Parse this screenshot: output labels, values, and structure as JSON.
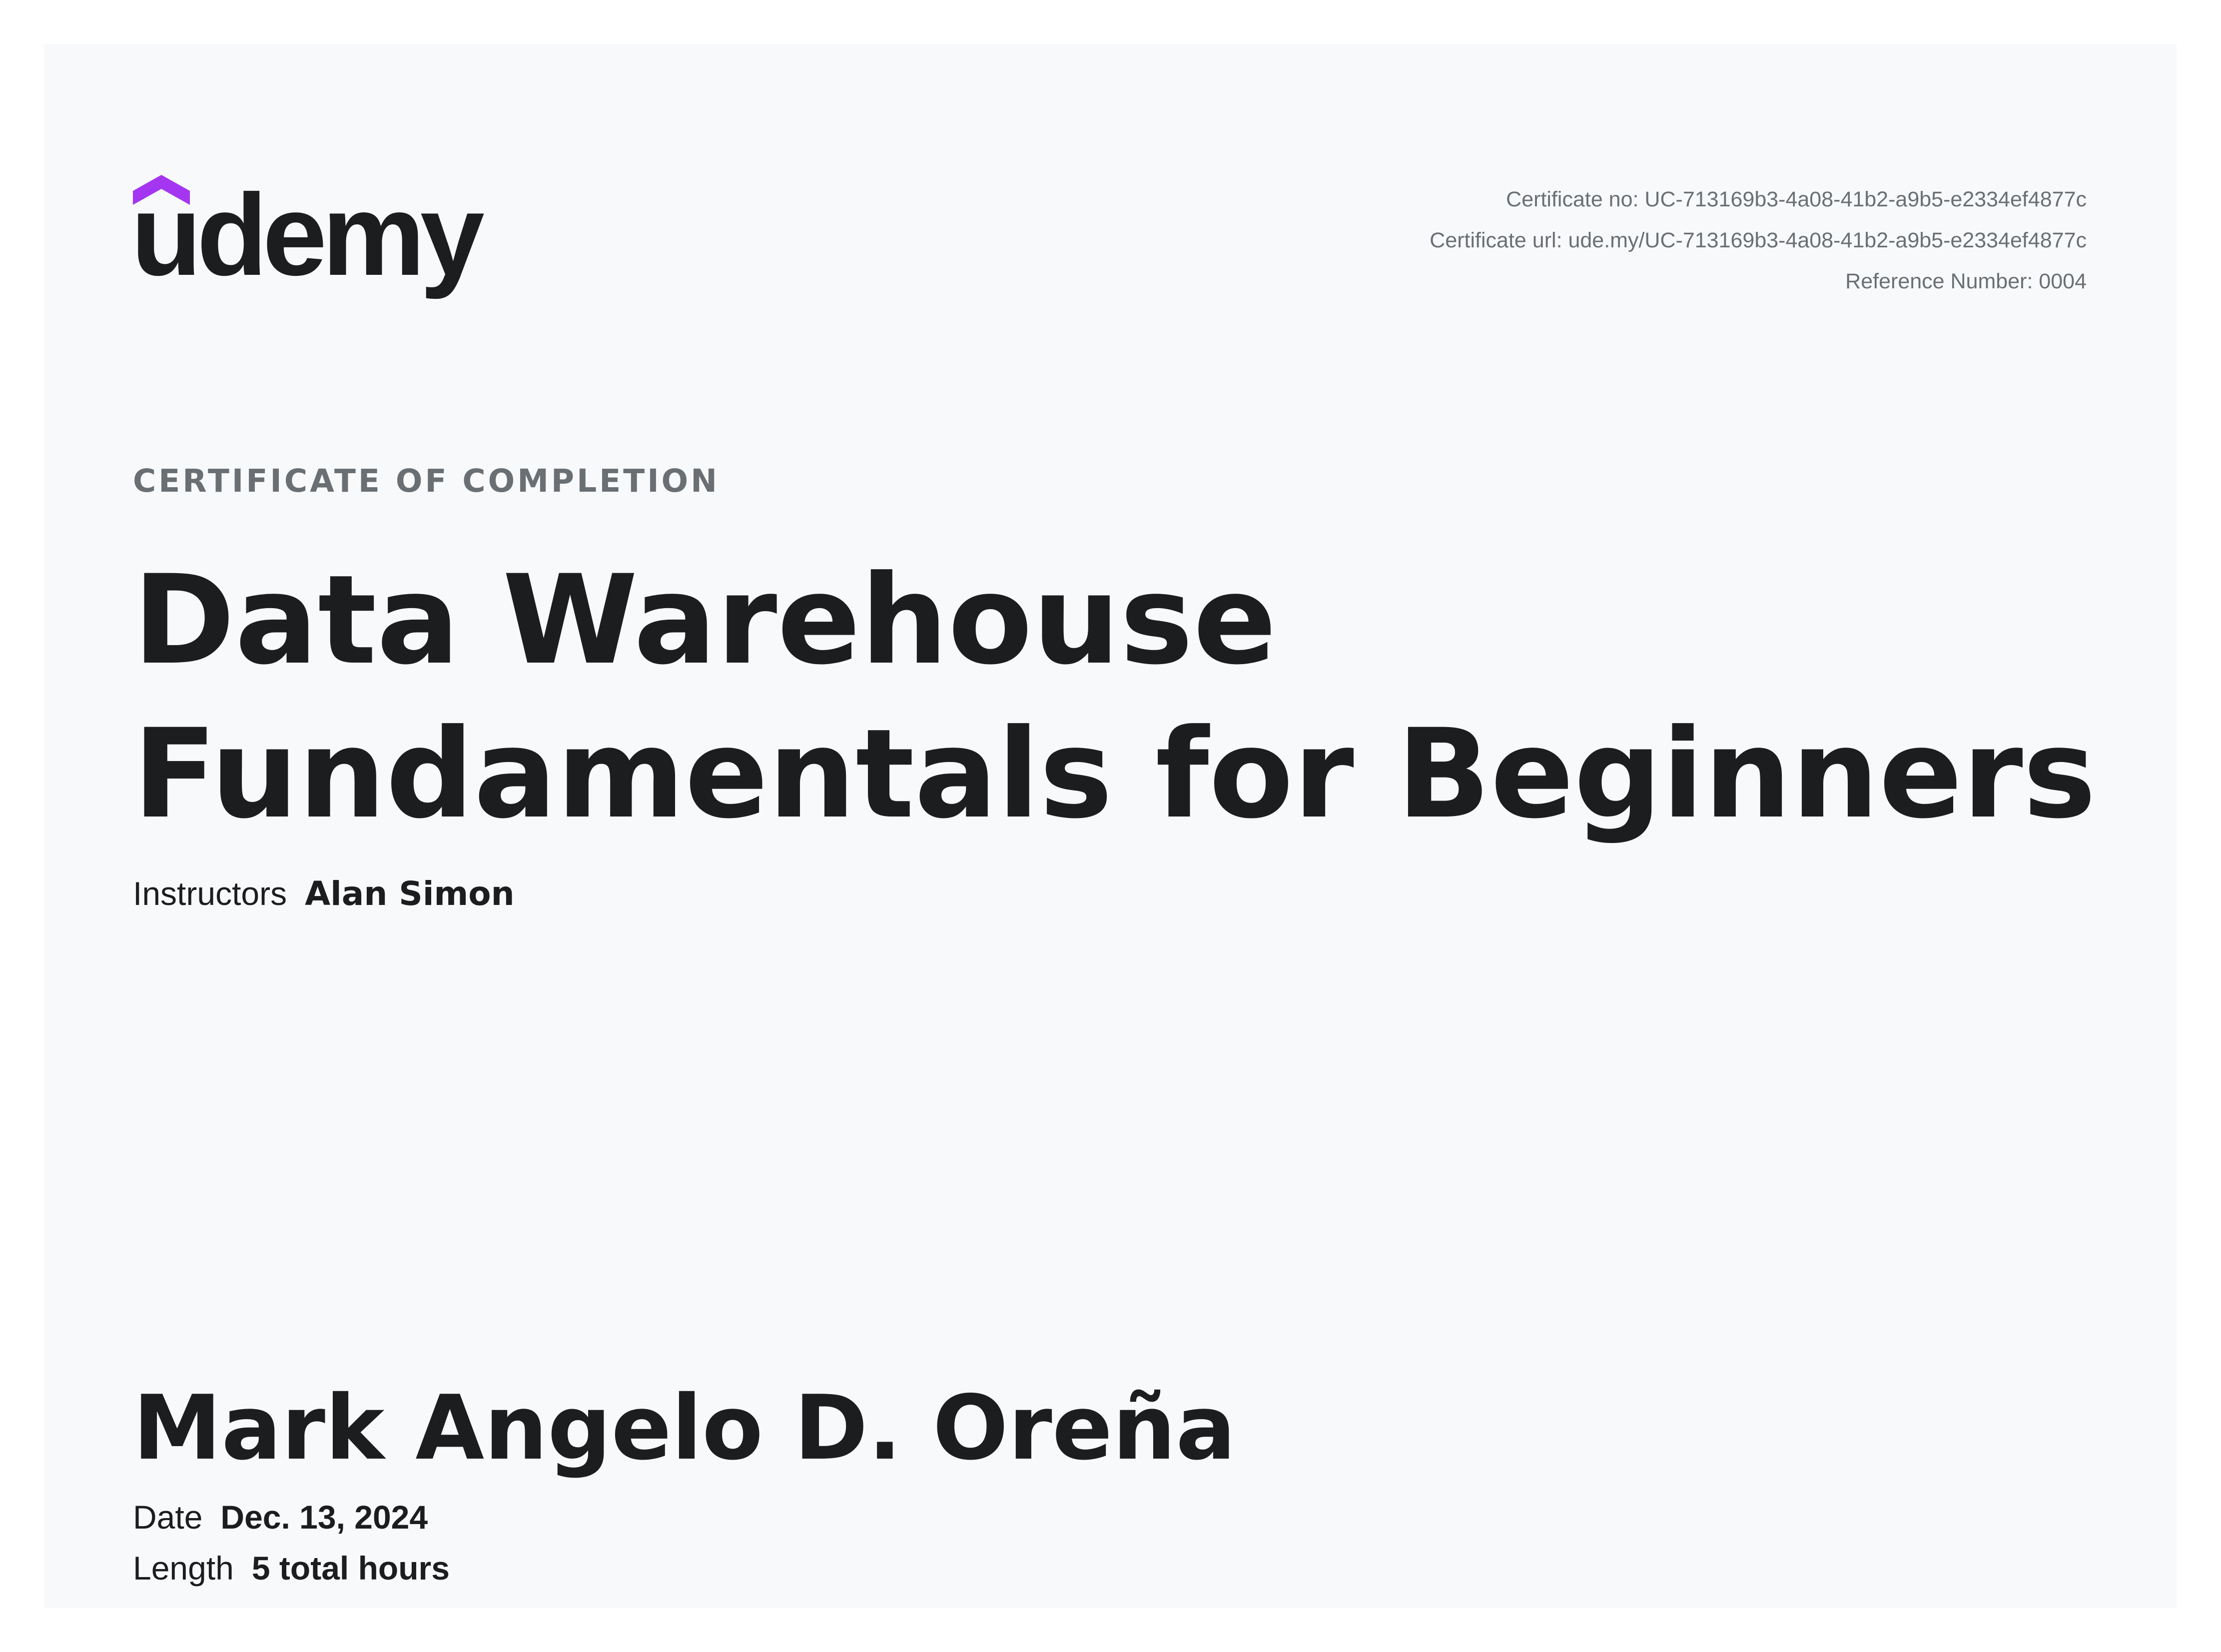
{
  "brand": {
    "name": "udemy",
    "accent_color": "#a435f0",
    "text_color": "#1c1d1f"
  },
  "meta": {
    "certificate_no": "Certificate no: UC-713169b3-4a08-41b2-a9b5-e2334ef4877c",
    "certificate_url": "Certificate url: ude.my/UC-713169b3-4a08-41b2-a9b5-e2334ef4877c",
    "reference_number": "Reference Number: 0004"
  },
  "certificate": {
    "kicker": "CERTIFICATE OF COMPLETION",
    "title_line1": "Data Warehouse",
    "title_line2": "Fundamentals for Beginners",
    "instructors_label": "Instructors",
    "instructors_value": "Alan Simon",
    "recipient": "Mark Angelo D. Oreña",
    "date_label": "Date",
    "date_value": "Dec. 13, 2024",
    "length_label": "Length",
    "length_value": "5 total hours"
  }
}
